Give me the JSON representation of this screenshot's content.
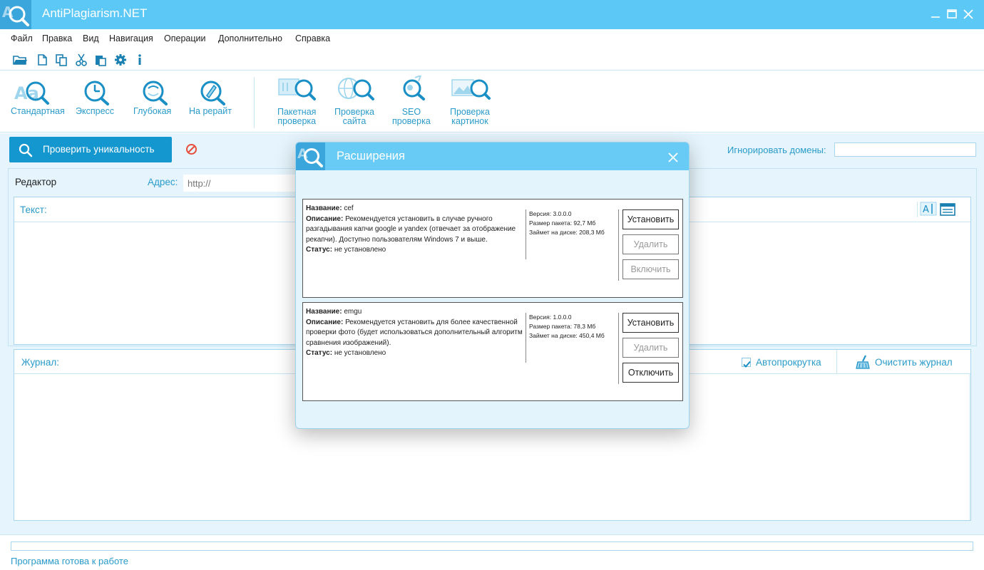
{
  "app": {
    "title": "AntiPlagiarism.NET"
  },
  "menu": [
    {
      "label": "Файл"
    },
    {
      "label": "Правка"
    },
    {
      "label": "Вид"
    },
    {
      "label": "Навигация"
    },
    {
      "label": "Операции"
    },
    {
      "label": "Дополнительно"
    },
    {
      "label": "Справка"
    }
  ],
  "toolbar_icons": [
    "open-folder-icon",
    "new-file-icon",
    "copy-icon",
    "cut-icon",
    "paste-icon",
    "settings-gear-icon",
    "info-icon"
  ],
  "ribbon": {
    "check_modes": [
      {
        "label": "Стандартная",
        "icon": "standard-check-icon"
      },
      {
        "label": "Экспресс",
        "icon": "express-check-icon"
      },
      {
        "label": "Глубокая",
        "icon": "deep-check-icon"
      },
      {
        "label": "На рерайт",
        "icon": "rewrite-check-icon"
      }
    ],
    "extra_modes": [
      {
        "label_line1": "Пакетная",
        "label_line2": "проверка",
        "icon": "batch-check-icon"
      },
      {
        "label_line1": "Проверка",
        "label_line2": "сайта",
        "icon": "site-check-icon"
      },
      {
        "label_line1": "SEO",
        "label_line2": "проверка",
        "icon": "seo-check-icon"
      },
      {
        "label_line1": "Проверка",
        "label_line2": "картинок",
        "icon": "image-check-icon"
      }
    ]
  },
  "actions": {
    "check_button": "Проверить уникальность",
    "ignore_domains_label": "Игнорировать домены:",
    "ignore_domains_value": ""
  },
  "editor": {
    "tab_label": "Редактор",
    "address_label": "Адрес:",
    "address_placeholder": "http://",
    "text_label": "Текст:"
  },
  "journal": {
    "label": "Журнал:",
    "autoscroll_label": "Автопрокрутка",
    "autoscroll_checked": true,
    "clear_label": "Очистить журнал"
  },
  "status": {
    "text": "Программа готова к работе",
    "progress": 0
  },
  "colors": {
    "accent": "#5cc8f5",
    "accent_dark": "#1496cf",
    "label_blue": "#2a9bc9",
    "panel_bg": "#e6f5fd"
  },
  "modal": {
    "title": "Расширения",
    "extensions": [
      {
        "name_label": "Название:",
        "name": "cef",
        "desc_label": "Описание:",
        "description": "Рекомендуется установить в случае ручного разгадывания капчи google и yandex (отвечает за отображение рекапчи). Доступно пользователям Windows 7 и выше.",
        "status_label": "Статус:",
        "status": "не установлено",
        "version": "Версия: 3.0.0.0",
        "package_size": "Размер пакета: 92,7 Мб",
        "disk_size": "Займет на диске: 208,3 Мб",
        "buttons": [
          "Установить",
          "Удалить",
          "Включить"
        ]
      },
      {
        "name_label": "Название:",
        "name": "emgu",
        "desc_label": "Описание:",
        "description": "Рекомендуется установить для более качественной проверки фото (будет использоваться дополнительный алгоритм сравнения изображений).",
        "status_label": "Статус:",
        "status": "не установлено",
        "version": "Версия: 1.0.0.0",
        "package_size": "Размер пакета: 78,3 Мб",
        "disk_size": "Займет на диске: 450,4 Мб",
        "buttons": [
          "Установить",
          "Удалить",
          "Отключить"
        ]
      }
    ]
  }
}
